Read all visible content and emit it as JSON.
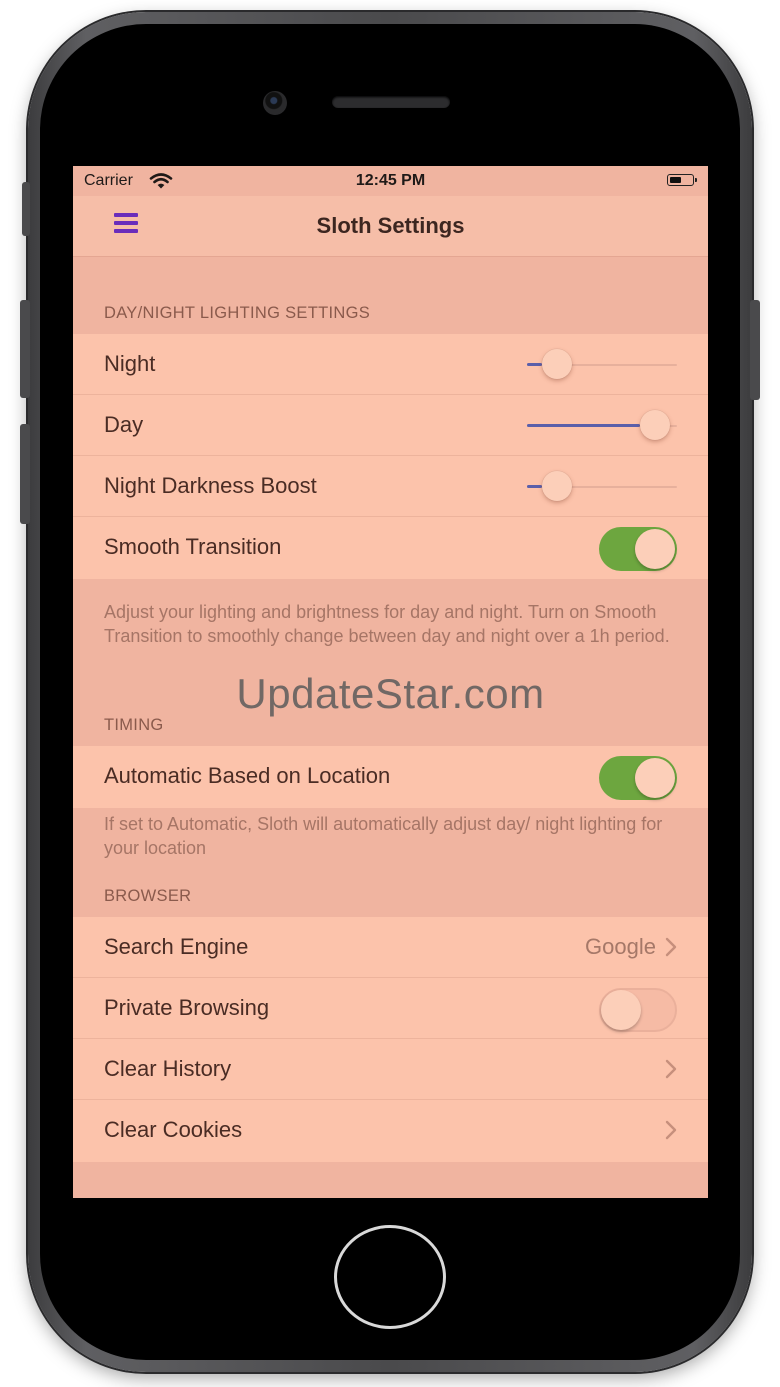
{
  "status_bar": {
    "carrier": "Carrier",
    "time": "12:45 PM",
    "wifi_icon": "wifi-icon",
    "battery_icon": "battery-icon"
  },
  "nav": {
    "title": "Sloth Settings",
    "menu_icon": "hamburger-menu-icon",
    "menu_color": "#6a2dbb"
  },
  "sections": {
    "lighting": {
      "header": "DAY/NIGHT LIGHTING SETTINGS",
      "rows": [
        {
          "label": "Night",
          "slider_value": 0.2
        },
        {
          "label": "Day",
          "slider_value": 0.85
        },
        {
          "label": "Night Darkness Boost",
          "slider_value": 0.2
        },
        {
          "label": "Smooth Transition",
          "toggle": true
        }
      ],
      "footer": "Adjust your lighting and brightness for day and night. Turn on Smooth Transition to smoothly change between day and night over a 1h period."
    },
    "timing": {
      "header": "TIMING",
      "rows": [
        {
          "label": "Automatic Based on Location",
          "toggle": true
        }
      ],
      "footer": "If set to Automatic, Sloth will automatically adjust day/ night lighting for your location"
    },
    "browser": {
      "header": "BROWSER",
      "rows": [
        {
          "label": "Search Engine",
          "value": "Google"
        },
        {
          "label": "Private Browsing",
          "toggle": false
        },
        {
          "label": "Clear History"
        },
        {
          "label": "Clear Cookies"
        }
      ]
    }
  },
  "watermark": "UpdateStar.com",
  "colors": {
    "screen_bg": "#f0b4a0",
    "cell_bg": "#fcc3ab",
    "toggle_on": "#6da63f",
    "slider_fill": "#5a5faa"
  }
}
